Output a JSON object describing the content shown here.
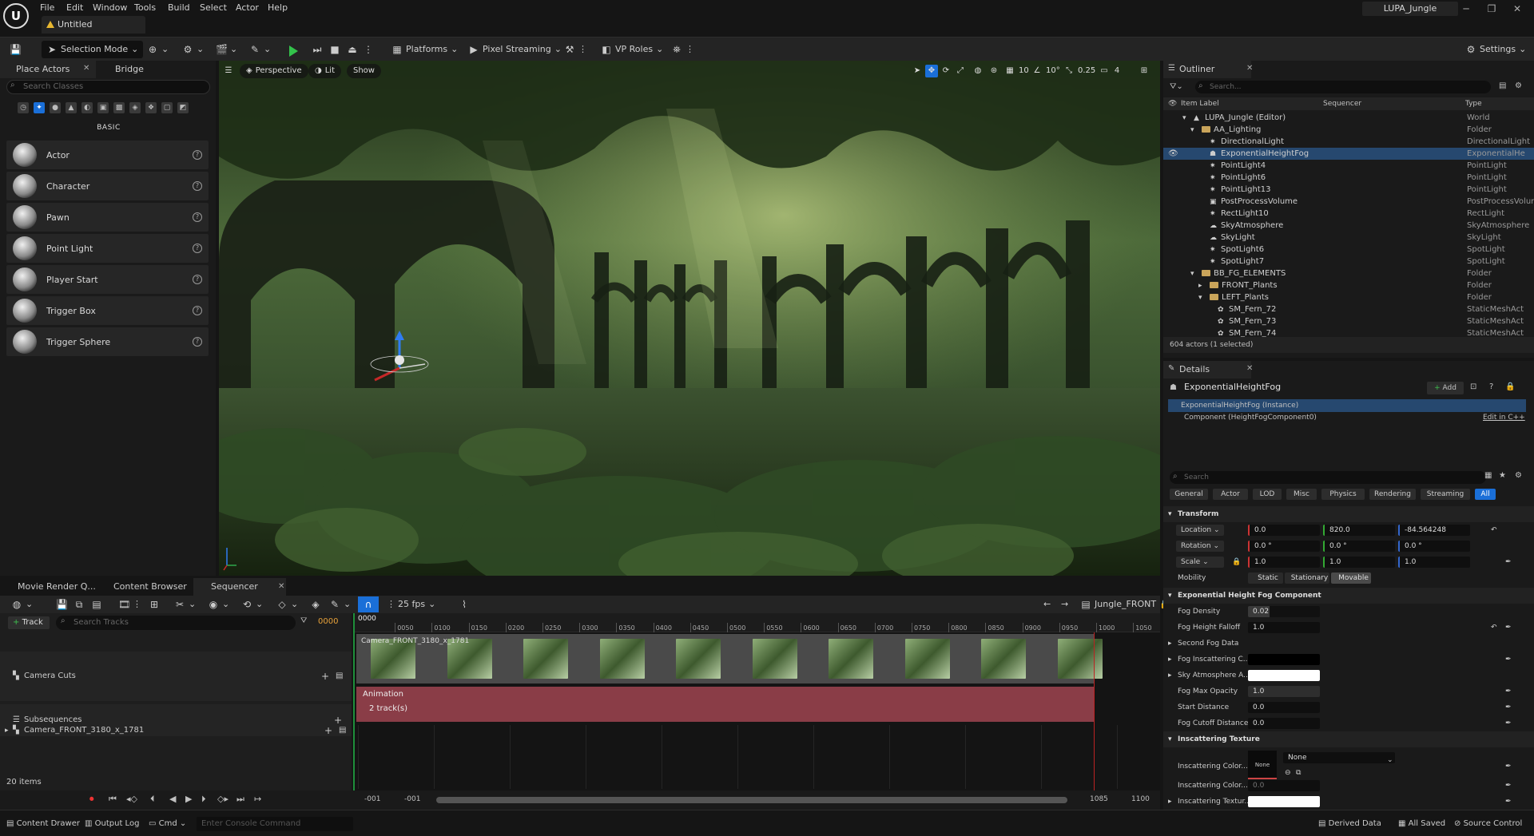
{
  "menu": [
    "File",
    "Edit",
    "Window",
    "Tools",
    "Build",
    "Select",
    "Actor",
    "Help"
  ],
  "doc_tab": "Untitled",
  "project_name": "LUPA_Jungle",
  "toolbar": {
    "selection_mode": "Selection Mode",
    "platforms": "Platforms",
    "pixel_streaming": "Pixel Streaming",
    "vp_roles": "VP Roles",
    "settings": "Settings"
  },
  "place_actors": {
    "tab": "Place Actors",
    "tab2": "Bridge",
    "search_placeholder": "Search Classes",
    "category": "BASIC",
    "items": [
      "Actor",
      "Character",
      "Pawn",
      "Point Light",
      "Player Start",
      "Trigger Box",
      "Trigger Sphere"
    ]
  },
  "viewport": {
    "perspective": "Perspective",
    "lit": "Lit",
    "show": "Show",
    "grid_snap": "10",
    "angle_snap": "10°",
    "scale_snap": "0.25",
    "camera_speed": "4"
  },
  "bottom_tabs": [
    "Movie Render Q...",
    "Content Browser",
    "Sequencer"
  ],
  "sequencer": {
    "fps": "25 fps",
    "sequence_name": "Jungle_FRONT",
    "track_button": "Track",
    "search_placeholder": "Search Tracks",
    "current_frame": "0000",
    "playhead_label": "0000",
    "tracks": [
      "Camera Cuts",
      "Subsequences",
      "Camera_FRONT_3180_x_1781"
    ],
    "item_count": "20 items",
    "ruler": [
      "0050",
      "0100",
      "0150",
      "0200",
      "0250",
      "0300",
      "0350",
      "0400",
      "0450",
      "0500",
      "0550",
      "0600",
      "0650",
      "0700",
      "0750",
      "0800",
      "0850",
      "0900",
      "0950",
      "1000",
      "1050"
    ],
    "camera_cut_label": "Camera_FRONT_3180_x_1781",
    "animation_label": "Animation",
    "animation_tracks": "2 track(s)",
    "range_start_a": "-001",
    "range_start_b": "-001",
    "range_end_a": "1085",
    "range_end_b": "1100"
  },
  "outliner": {
    "tab": "Outliner",
    "search_placeholder": "Search...",
    "col_label": "Item Label",
    "col_sequencer": "Sequencer",
    "col_type": "Type",
    "rows": [
      {
        "name": "LUPA_Jungle (Editor)",
        "type": "World",
        "indent": 0,
        "kind": "world"
      },
      {
        "name": "AA_Lighting",
        "type": "Folder",
        "indent": 1,
        "kind": "folder"
      },
      {
        "name": "DirectionalLight",
        "type": "DirectionalLight",
        "indent": 2,
        "kind": "light"
      },
      {
        "name": "ExponentialHeightFog",
        "type": "ExponentialHe",
        "indent": 2,
        "kind": "fog"
      },
      {
        "name": "PointLight4",
        "type": "PointLight",
        "indent": 2,
        "kind": "light"
      },
      {
        "name": "PointLight6",
        "type": "PointLight",
        "indent": 2,
        "kind": "light"
      },
      {
        "name": "PointLight13",
        "type": "PointLight",
        "indent": 2,
        "kind": "light"
      },
      {
        "name": "PostProcessVolume",
        "type": "PostProcessVolume",
        "indent": 2,
        "kind": "volume"
      },
      {
        "name": "RectLight10",
        "type": "RectLight",
        "indent": 2,
        "kind": "light"
      },
      {
        "name": "SkyAtmosphere",
        "type": "SkyAtmosphere",
        "indent": 2,
        "kind": "sky"
      },
      {
        "name": "SkyLight",
        "type": "SkyLight",
        "indent": 2,
        "kind": "sky"
      },
      {
        "name": "SpotLight6",
        "type": "SpotLight",
        "indent": 2,
        "kind": "light"
      },
      {
        "name": "SpotLight7",
        "type": "SpotLight",
        "indent": 2,
        "kind": "light"
      },
      {
        "name": "BB_FG_ELEMENTS",
        "type": "Folder",
        "indent": 1,
        "kind": "folder"
      },
      {
        "name": "FRONT_Plants",
        "type": "Folder",
        "indent": 2,
        "kind": "folder"
      },
      {
        "name": "LEFT_Plants",
        "type": "Folder",
        "indent": 2,
        "kind": "folder"
      },
      {
        "name": "SM_Fern_72",
        "type": "StaticMeshAct",
        "indent": 3,
        "kind": "mesh"
      },
      {
        "name": "SM_Fern_73",
        "type": "StaticMeshAct",
        "indent": 3,
        "kind": "mesh"
      },
      {
        "name": "SM_Fern_74",
        "type": "StaticMeshAct",
        "indent": 3,
        "kind": "mesh"
      }
    ],
    "selected_index": 3,
    "actor_count": "604 actors (1 selected)"
  },
  "details": {
    "tab": "Details",
    "title": "ExponentialHeightFog",
    "add": "Add",
    "instance": "ExponentialHeightFog (Instance)",
    "component": "Component (HeightFogComponent0)",
    "edit_cpp": "Edit in C++",
    "search_placeholder": "Search",
    "filters": [
      "General",
      "Actor",
      "LOD",
      "Misc",
      "Physics",
      "Rendering",
      "Streaming",
      "All"
    ],
    "transform": {
      "title": "Transform",
      "location_label": "Location",
      "location": [
        "0.0",
        "820.0",
        "-84.564248"
      ],
      "rotation_label": "Rotation",
      "rotation": [
        "0.0 °",
        "0.0 °",
        "0.0 °"
      ],
      "scale_label": "Scale",
      "scale": [
        "1.0",
        "1.0",
        "1.0"
      ],
      "mobility_label": "Mobility",
      "mobility": [
        "Static",
        "Stationary",
        "Movable"
      ]
    },
    "fog": {
      "title": "Exponential Height Fog Component",
      "fog_density_label": "Fog Density",
      "fog_density": "0.02",
      "fog_density_fill": 0.3,
      "fog_height_falloff_label": "Fog Height Falloff",
      "fog_height_falloff": "1.0",
      "second_fog_label": "Second Fog Data",
      "inscattering_color_label": "Fog Inscattering C...",
      "sky_atmo_label": "Sky Atmosphere A...",
      "fog_max_opacity_label": "Fog Max Opacity",
      "fog_max_opacity": "1.0",
      "start_distance_label": "Start Distance",
      "start_distance": "0.0",
      "cutoff_label": "Fog Cutoff Distance",
      "cutoff": "0.0"
    },
    "inscatter_tex": {
      "title": "Inscattering Texture",
      "color_label": "Inscattering Color...",
      "none_thumb": "None",
      "none_value": "None",
      "color2_label": "Inscattering Color...",
      "color2_value": "0.0",
      "tex_label": "Inscattering Textur..."
    }
  },
  "statusbar": {
    "content_drawer": "Content Drawer",
    "output_log": "Output Log",
    "cmd": "Cmd",
    "console_placeholder": "Enter Console Command",
    "derived_data": "Derived Data",
    "all_saved": "All Saved",
    "source_control": "Source Control"
  }
}
